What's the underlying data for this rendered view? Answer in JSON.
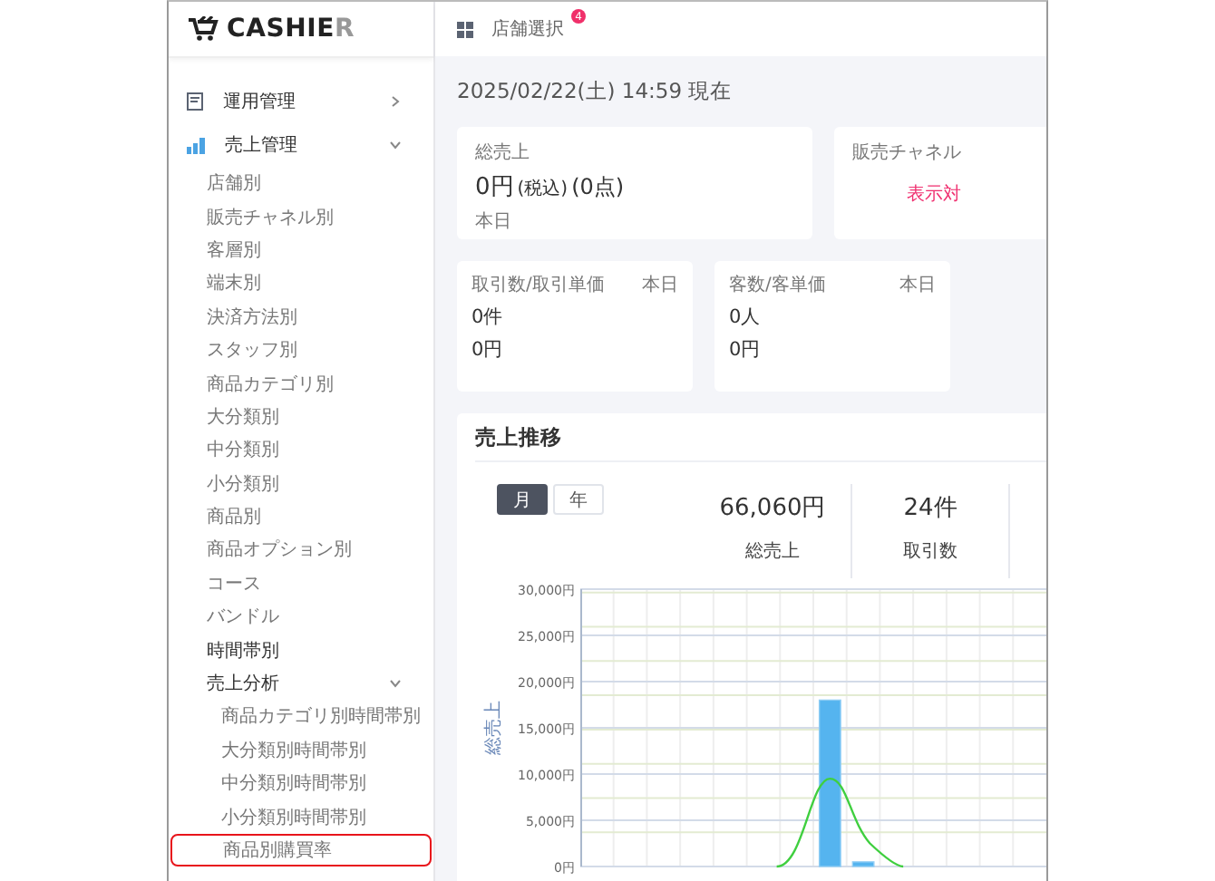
{
  "logo": {
    "text": "CASHIE",
    "faded_text": "R"
  },
  "sidebar": {
    "items": [
      {
        "label": "運用管理",
        "expanded": false,
        "selected": false
      },
      {
        "label": "売上管理",
        "expanded": true,
        "selected": false,
        "children": [
          {
            "label": "店舗別",
            "kind": "link",
            "selected": false
          },
          {
            "label": "販売チャネル別",
            "kind": "link",
            "selected": false
          },
          {
            "label": "客層別",
            "kind": "link",
            "selected": false
          },
          {
            "label": "端末別",
            "kind": "link",
            "selected": false
          },
          {
            "label": "決済方法別",
            "kind": "link",
            "selected": false
          },
          {
            "label": "スタッフ別",
            "kind": "link",
            "selected": false
          },
          {
            "label": "商品カテゴリ別",
            "kind": "link",
            "selected": false
          },
          {
            "label": "大分類別",
            "kind": "link",
            "selected": false
          },
          {
            "label": "中分類別",
            "kind": "link",
            "selected": false
          },
          {
            "label": "小分類別",
            "kind": "link",
            "selected": false
          },
          {
            "label": "商品別",
            "kind": "link",
            "selected": false
          },
          {
            "label": "商品オプション別",
            "kind": "link",
            "selected": false
          },
          {
            "label": "コース",
            "kind": "link",
            "selected": false
          },
          {
            "label": "バンドル",
            "kind": "link",
            "selected": false
          },
          {
            "label": "時間帯別",
            "kind": "group",
            "selected": false
          },
          {
            "label": "売上分析",
            "kind": "group",
            "expanded": true,
            "selected": false,
            "children": [
              {
                "label": "商品カテゴリ別時間帯別",
                "kind": "link",
                "selected": false
              },
              {
                "label": "大分類別時間帯別",
                "kind": "link",
                "selected": false
              },
              {
                "label": "中分類別時間帯別",
                "kind": "link",
                "selected": false
              },
              {
                "label": "小分類別時間帯別",
                "kind": "link",
                "selected": false
              },
              {
                "label": "商品別購買率",
                "kind": "link",
                "selected": true
              }
            ]
          }
        ]
      }
    ]
  },
  "topbar": {
    "store_select": "店舗選択",
    "badge": "4"
  },
  "timestamp": "2025/02/22(土) 14:59 現在",
  "total_sales_card": {
    "title": "総売上",
    "amount": "0円",
    "tax_note": "(税込)",
    "count": "(0点)",
    "period": "本日"
  },
  "channel_card": {
    "title": "販売チャネル",
    "link": "表示対"
  },
  "stat_cards": [
    {
      "title": "取引数/取引単価",
      "period": "本日",
      "primary": "0件",
      "secondary": "0円"
    },
    {
      "title": "客数/客単価",
      "period": "本日",
      "primary": "0人",
      "secondary": "0円"
    }
  ],
  "sales_trend": {
    "title": "売上推移",
    "period_tabs": [
      {
        "label": "月",
        "selected": true
      },
      {
        "label": "年",
        "selected": false
      }
    ],
    "stats": [
      {
        "value": "66,060円",
        "label": "総売上"
      },
      {
        "value": "24件",
        "label": "取引数"
      }
    ],
    "chart_data": {
      "type": "bar",
      "ylabel": "総売上",
      "values": [
        null,
        null,
        null,
        null,
        null,
        null,
        null,
        18000,
        500,
        null,
        null,
        null,
        null,
        null
      ],
      "ylim": [
        0,
        30000
      ],
      "grid": true,
      "yticks": [
        {
          "value": 0,
          "label": "0円"
        },
        {
          "value": 5000,
          "label": "5,000円"
        },
        {
          "value": 10000,
          "label": "10,000円"
        },
        {
          "value": 15000,
          "label": "15,000円"
        },
        {
          "value": 20000,
          "label": "20,000円"
        },
        {
          "value": 25000,
          "label": "25,000円"
        },
        {
          "value": 30000,
          "label": "30,000円"
        }
      ]
    }
  }
}
